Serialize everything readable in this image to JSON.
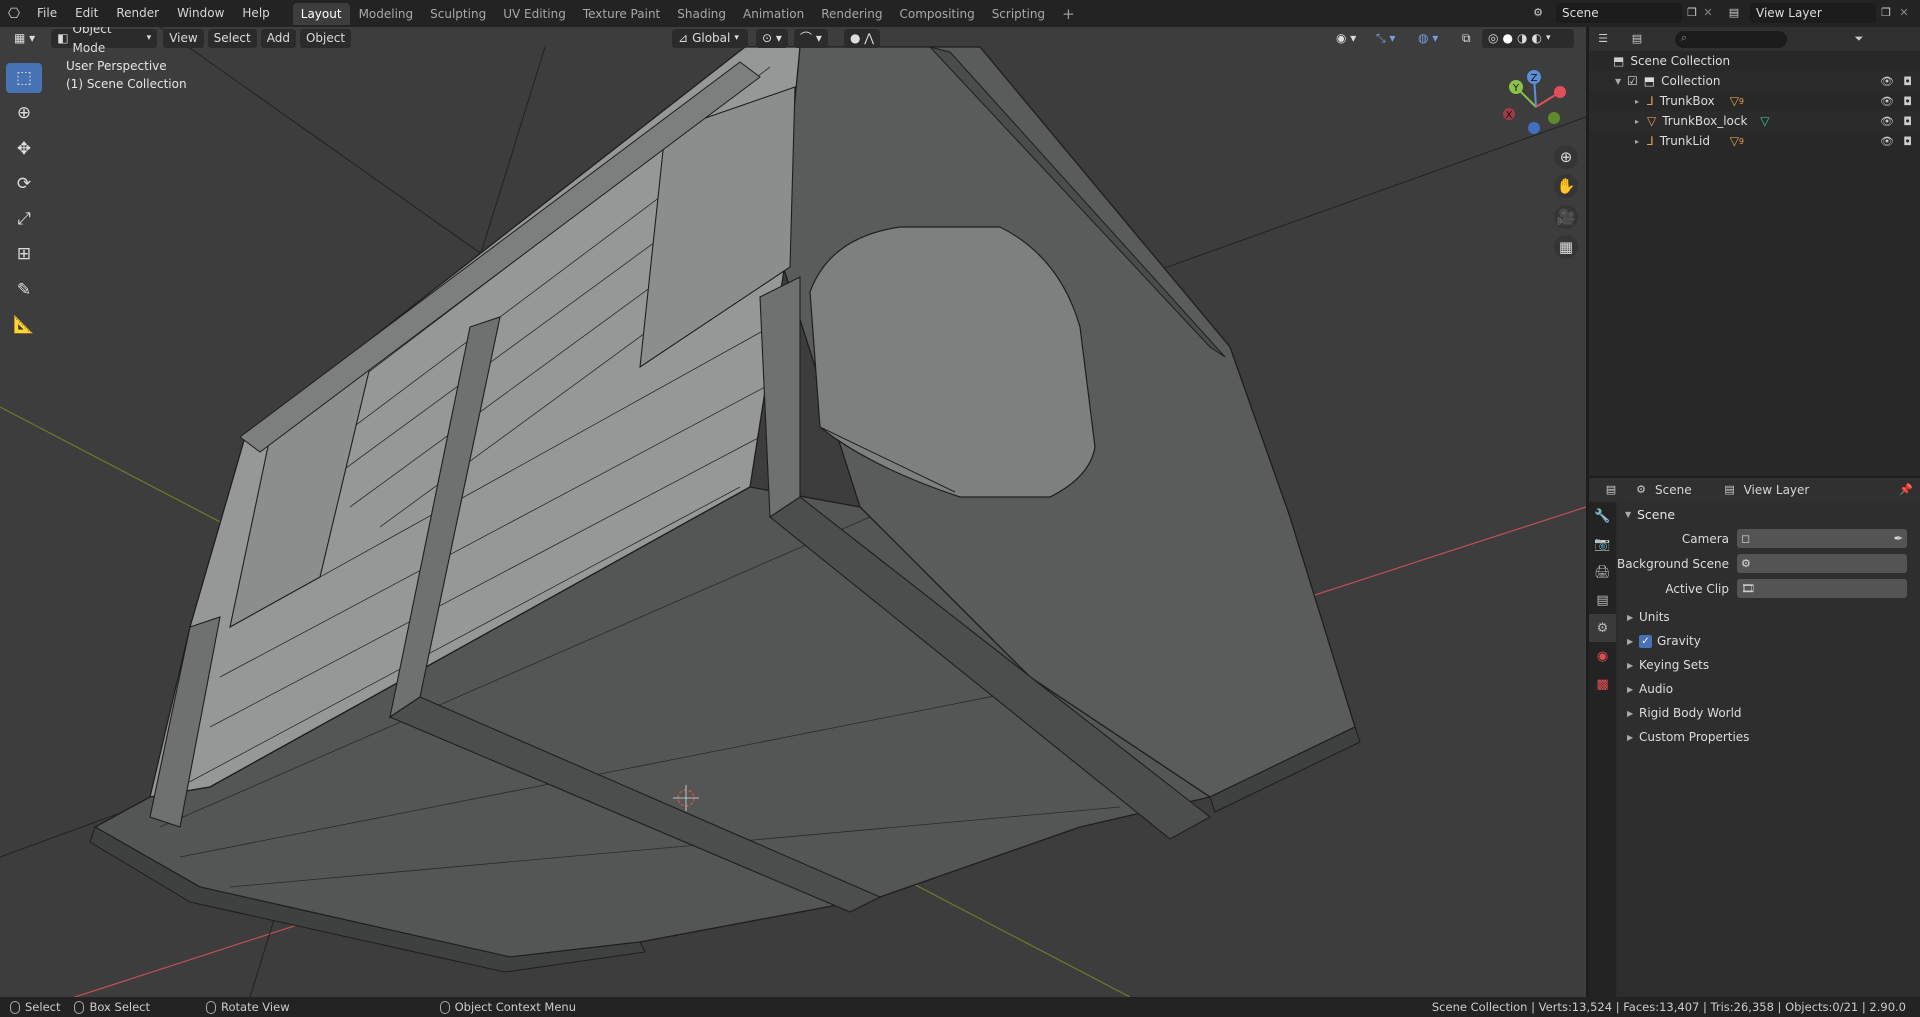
{
  "menu": {
    "items": [
      "File",
      "Edit",
      "Render",
      "Window",
      "Help"
    ]
  },
  "workspaces": {
    "tabs": [
      "Layout",
      "Modeling",
      "Sculpting",
      "UV Editing",
      "Texture Paint",
      "Shading",
      "Animation",
      "Rendering",
      "Compositing",
      "Scripting"
    ],
    "active": "Layout"
  },
  "top_right": {
    "scene": "Scene",
    "view_layer": "View Layer"
  },
  "viewport_header": {
    "mode": "Object Mode",
    "view": "View",
    "select": "Select",
    "add": "Add",
    "object": "Object",
    "orientation": "Global"
  },
  "viewport_info": {
    "perspective": "User Perspective",
    "collection": "(1) Scene Collection"
  },
  "gizmo": {
    "x": "X",
    "y": "Y",
    "z": "Z"
  },
  "outliner": {
    "root": "Scene Collection",
    "collection": "Collection",
    "items": [
      {
        "name": "TrunkBox",
        "modifier_count": "9"
      },
      {
        "name": "TrunkBox_lock",
        "modifier_count": ""
      },
      {
        "name": "TrunkLid",
        "modifier_count": "9"
      }
    ]
  },
  "properties": {
    "header_scene": "Scene",
    "header_view_layer": "View Layer",
    "section_title": "Scene",
    "fields": [
      {
        "label": "Camera"
      },
      {
        "label": "Background Scene"
      },
      {
        "label": "Active Clip"
      }
    ],
    "subsections": [
      "Units",
      "Gravity",
      "Keying Sets",
      "Audio",
      "Rigid Body World",
      "Custom Properties"
    ],
    "gravity_checked": true
  },
  "statusbar": {
    "select": "Select",
    "box_select": "Box Select",
    "rotate_view": "Rotate View",
    "context_menu": "Object Context Menu",
    "stats": "Scene Collection | Verts:13,524 | Faces:13,407 | Tris:26,358 | Objects:0/21 | 2.90.0"
  },
  "colors": {
    "accent": "#4772b3",
    "axis_x": "#c0505a",
    "axis_y": "#7a9a2a",
    "viewport_bg": "#3d3d3d"
  }
}
